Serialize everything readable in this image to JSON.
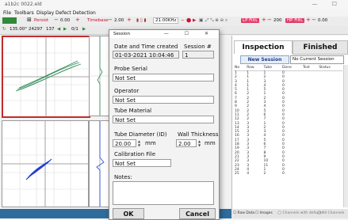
{
  "window": {
    "title": "a1b2c 0022.eld",
    "controls": "— ☐"
  },
  "menu": [
    "File",
    "Toolbars",
    "Display",
    "Defect Detection"
  ],
  "toolbar1": {
    "persist_label": "Persist",
    "persist_value": "0.00",
    "timebase_label": "Timebase",
    "timebase_value": "2.00",
    "freq_value": "21.00KHz",
    "lpfilt_label": "LP FiltL",
    "lpfilt_value": "200",
    "hpfilt_label": "HP FiltL",
    "hpfilt_value": "0.00"
  },
  "toolbar2": {
    "angle_a": "135.00°",
    "angle_b": "24297",
    "angle_c": "137",
    "page": "0/1"
  },
  "dialog": {
    "title": "Session",
    "controls": "— ☐ ✕",
    "date_label": "Date and Time created",
    "date_value": "01-03-2021 10:04:46",
    "session_label": "Session #",
    "session_value": "1",
    "probe_label": "Probe Serial",
    "probe_value": "Not Set",
    "operator_label": "Operator",
    "operator_value": "Not Set",
    "material_label": "Tube Material",
    "material_value": "Not Set",
    "diameter_label": "Tube Diameter (ID)",
    "diameter_value": "20.00",
    "diameter_unit": "mm",
    "wall_label": "Wall Thickness",
    "wall_value": "2.00",
    "wall_unit": "mm",
    "cal_label": "Calibration File",
    "cal_value": "Not Set",
    "notes_label": "Notes:",
    "notes_value": "",
    "ok_label": "OK",
    "cancel_label": "Cancel"
  },
  "panel": {
    "tab_inspection": "Inspection Plan",
    "tab_finished": "Finished",
    "new_session": "New Session",
    "current_session": "No Current Session",
    "columns": [
      "No",
      "Row",
      "Tube",
      "Done",
      "Test",
      "Status"
    ],
    "rows": [
      [
        "1",
        "1",
        "1",
        "0"
      ],
      [
        "2",
        "1",
        "2",
        "0"
      ],
      [
        "3",
        "1",
        "3",
        "0"
      ],
      [
        "4",
        "1",
        "4",
        "0"
      ],
      [
        "5",
        "1",
        "5",
        "0"
      ],
      [
        "6",
        "2",
        "1",
        "0"
      ],
      [
        "7",
        "2",
        "2",
        "0"
      ],
      [
        "8",
        "2",
        "3",
        "0"
      ],
      [
        "9",
        "2",
        "4",
        "0"
      ],
      [
        "10",
        "2",
        "5",
        "0"
      ],
      [
        "11",
        "2",
        "6",
        "0"
      ],
      [
        "12",
        "2",
        "7",
        "0"
      ],
      [
        "13",
        "3",
        "1",
        "0"
      ],
      [
        "14",
        "3",
        "2",
        "0"
      ],
      [
        "15",
        "3",
        "3",
        "0"
      ],
      [
        "16",
        "3",
        "4",
        "0"
      ],
      [
        "17",
        "3",
        "5",
        "0"
      ],
      [
        "18",
        "3",
        "6",
        "0"
      ],
      [
        "19",
        "3",
        "7",
        "0"
      ],
      [
        "20",
        "3",
        "8",
        "0"
      ],
      [
        "21",
        "3",
        "9",
        "0"
      ],
      [
        "22",
        "3",
        "10",
        "0"
      ],
      [
        "23",
        "3",
        "11",
        "0"
      ],
      [
        "24",
        "4",
        "1",
        "0"
      ],
      [
        "25",
        "4",
        "2",
        "0"
      ]
    ],
    "raw_data": "Raw Data",
    "images": "Images",
    "footer_a": "Channels with defaults",
    "footer_b": "All Channels"
  },
  "colors": {
    "accent": "#c32b2b",
    "status_bar": "#2e6c9b",
    "plot_green": "#2e8b57",
    "plot_blue": "#1f3fd1"
  }
}
